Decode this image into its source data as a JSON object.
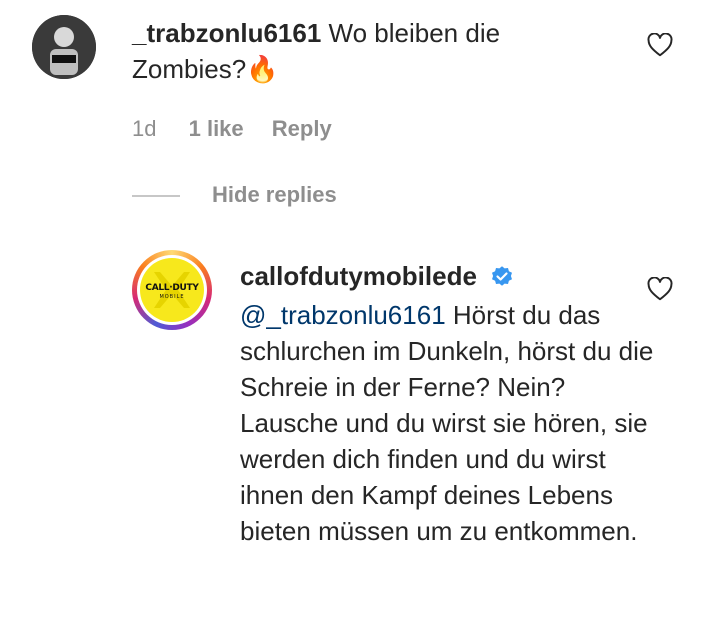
{
  "comment": {
    "username": "_trabzonlu6161",
    "text": "Wo bleiben die Zombies?",
    "emoji": "🔥",
    "time": "1d",
    "likes": "1 like",
    "reply_label": "Reply",
    "hide_replies": "Hide replies"
  },
  "reply": {
    "username": "callofdutymobilede",
    "mention": "@_trabzonlu6161",
    "text": "Hörst du das schlurchen im Dunkeln, hörst du die Schreie in der Ferne? Nein? Lausche und du wirst sie hören, sie werden dich finden und du wirst ihnen den Kampf deines Lebens bieten müssen um zu entkommen.",
    "logo_text": "CALL·DUTY",
    "logo_sub": "MOBILE"
  },
  "icons": {
    "like": "heart-outline-icon",
    "verified": "verified-badge-icon"
  },
  "colors": {
    "verified": "#3897f0",
    "logo_bg": "#f7e81c",
    "meta_text": "#8e8e8e",
    "mention": "#00376b"
  }
}
